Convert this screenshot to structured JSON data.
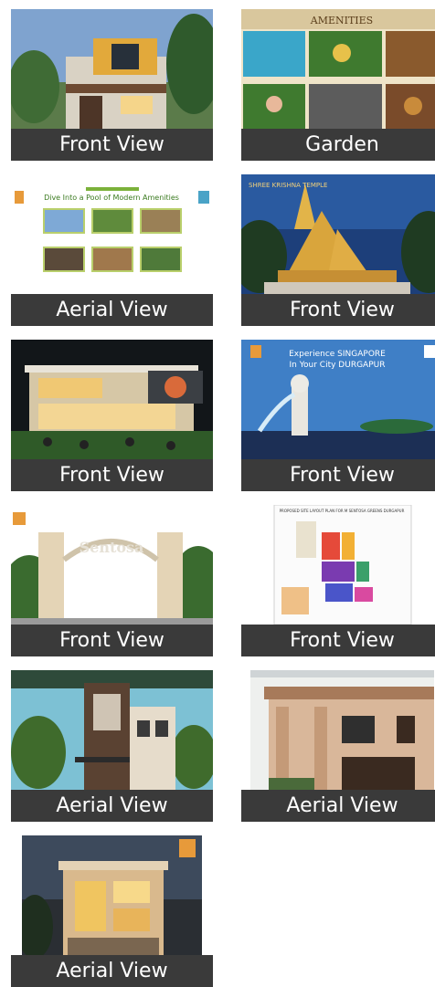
{
  "gallery": {
    "tiles": [
      {
        "caption": "Front View",
        "image": "house-photo"
      },
      {
        "caption": "Garden",
        "image": "amenities-collage",
        "banner": "AMENITIES"
      },
      {
        "caption": "Aerial View",
        "image": "amenities-brochure",
        "heading": "Dive Into a Pool of Modern Amenities"
      },
      {
        "caption": "Front View",
        "image": "temple-photo",
        "banner": "SHREE KRISHNA TEMPLE"
      },
      {
        "caption": "Front View",
        "image": "clubhouse-photo"
      },
      {
        "caption": "Front View",
        "image": "merlion-poster",
        "line1": "Experience SINGAPORE",
        "line2": "In Your City DURGAPUR"
      },
      {
        "caption": "Front View",
        "image": "gate-photo"
      },
      {
        "caption": "Front View",
        "image": "site-plan",
        "heading": "PROPOSED SITE LAYOUT PLAN FOR M SENTOSA GREENS DURGAPUR"
      },
      {
        "caption": "Aerial View",
        "image": "villa-photo"
      },
      {
        "caption": "Aerial View",
        "image": "bungalow-photo"
      },
      {
        "caption": "Aerial View",
        "image": "duplex-photo"
      }
    ]
  }
}
